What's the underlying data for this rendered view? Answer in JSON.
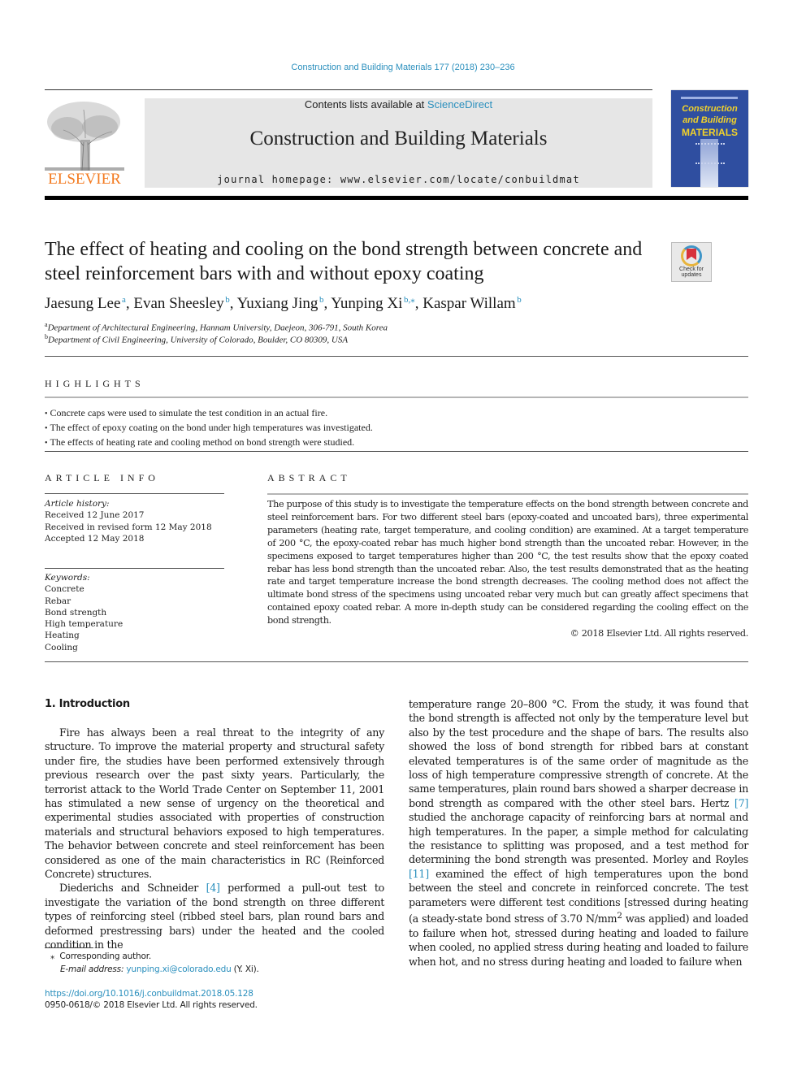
{
  "header": {
    "journal_ref": "Construction and Building Materials 177 (2018) 230–236",
    "contents_prefix": "Contents lists available at ",
    "contents_link": "ScienceDirect",
    "journal_title": "Construction and Building Materials",
    "homepage": "journal homepage: www.elsevier.com/locate/conbuildmat",
    "publisher_logo_text": "ELSEVIER",
    "cover": {
      "title_line1": "Construction",
      "title_line2": "and Building",
      "title_line3": "MATERIALS"
    },
    "colors": {
      "link": "#2a8fbd",
      "elsevier_orange": "#f37a20",
      "cover_blue": "#2f4ea0",
      "cover_yellow": "#f2d22a"
    }
  },
  "article": {
    "title": "The effect of heating and cooling on the bond strength between concrete and steel reinforcement bars with and without epoxy coating",
    "check_updates": {
      "line1": "Check for",
      "line2": "updates"
    },
    "authors": [
      {
        "name": "Jaesung Lee",
        "sup": "a"
      },
      {
        "name": "Evan Sheesley",
        "sup": "b"
      },
      {
        "name": "Yuxiang Jing",
        "sup": "b"
      },
      {
        "name": "Yunping Xi",
        "sup": "b,⁎"
      },
      {
        "name": "Kaspar Willam",
        "sup": "b"
      }
    ],
    "affiliations": [
      {
        "mark": "a",
        "text": "Department of Architectural Engineering, Hannam University, Daejeon, 306-791, South Korea"
      },
      {
        "mark": "b",
        "text": "Department of Civil Engineering, University of Colorado, Boulder, CO 80309, USA"
      }
    ]
  },
  "highlights": {
    "heading": "HIGHLIGHTS",
    "items": [
      "Concrete caps were used to simulate the test condition in an actual fire.",
      "The effect of epoxy coating on the bond under high temperatures was investigated.",
      "The effects of heating rate and cooling method on bond strength were studied."
    ]
  },
  "article_info": {
    "heading": "ARTICLE INFO",
    "history_label": "Article history:",
    "history": [
      "Received 12 June 2017",
      "Received in revised form 12 May 2018",
      "Accepted 12 May 2018"
    ],
    "keywords_label": "Keywords:",
    "keywords": [
      "Concrete",
      "Rebar",
      "Bond strength",
      "High temperature",
      "Heating",
      "Cooling"
    ]
  },
  "abstract": {
    "heading": "ABSTRACT",
    "text": "The purpose of this study is to investigate the temperature effects on the bond strength between concrete and steel reinforcement bars. For two different steel bars (epoxy-coated and uncoated bars), three experimental parameters (heating rate, target temperature, and cooling condition) are examined. At a target temperature of 200 °C, the epoxy-coated rebar has much higher bond strength than the uncoated rebar. However, in the specimens exposed to target temperatures higher than 200 °C, the test results show that the epoxy coated rebar has less bond strength than the uncoated rebar. Also, the test results demonstrated that as the heating rate and target temperature increase the bond strength decreases. The cooling method does not affect the ultimate bond stress of the specimens using uncoated rebar very much but can greatly affect specimens that contained epoxy coated rebar. A more in-depth study can be considered regarding the cooling effect on the bond strength.",
    "copyright": "© 2018 Elsevier Ltd. All rights reserved."
  },
  "introduction": {
    "heading": "1. Introduction",
    "p1": "Fire has always been a real threat to the integrity of any structure. To improve the material property and structural safety under fire, the studies have been performed extensively through previous research over the past sixty years. Particularly, the terrorist attack to the World Trade Center on September 11, 2001 has stimulated a new sense of urgency on the theoretical and experimental studies associated with properties of construction materials and structural behaviors exposed to high temperatures. The behavior between concrete and steel reinforcement has been considered as one of the main characteristics in RC (Reinforced Concrete) structures.",
    "p2_a": "Diederichs and Schneider ",
    "p2_ref": "[4]",
    "p2_b": " performed a pull-out test to investigate the variation of the bond strength on three different types of reinforcing steel (ribbed steel bars, plan round bars and deformed prestressing bars) under the heated and the cooled condition in the",
    "r1_a": "temperature range 20–800 °C. From the study, it was found that the bond strength is affected not only by the temperature level but also by the test procedure and the shape of bars. The results also showed the loss of bond strength for ribbed bars at constant elevated temperatures is of the same order of magnitude as the loss of high temperature compressive strength of concrete. At the same temperatures, plain round bars showed a sharper decrease in bond strength as compared with the other steel bars. Hertz ",
    "r1_ref1": "[7]",
    "r1_b": " studied the anchorage capacity of reinforcing bars at normal and high temperatures. In the paper, a simple method for calculating the resistance to splitting was proposed, and a test method for determining the bond strength was presented. Morley and Royles ",
    "r1_ref2": "[11]",
    "r1_c": " examined the effect of high temperatures upon the bond between the steel and concrete in reinforced concrete. The test parameters were different test conditions [stressed during heating (a steady-state bond stress of 3.70 N/mm",
    "r1_sup": "2",
    "r1_d": " was applied) and loaded to failure when hot, stressed during heating and loaded to failure when cooled, no applied stress during heating and loaded to failure when hot, and no stress during heating and loaded to failure when"
  },
  "footnotes": {
    "star": "⁎",
    "corresponding": "Corresponding author.",
    "email_label": "E-mail address: ",
    "email": "yunping.xi@colorado.edu",
    "email_suffix": " (Y. Xi).",
    "doi": "https://doi.org/10.1016/j.conbuildmat.2018.05.128",
    "issn": "0950-0618/© 2018 Elsevier Ltd. All rights reserved."
  }
}
